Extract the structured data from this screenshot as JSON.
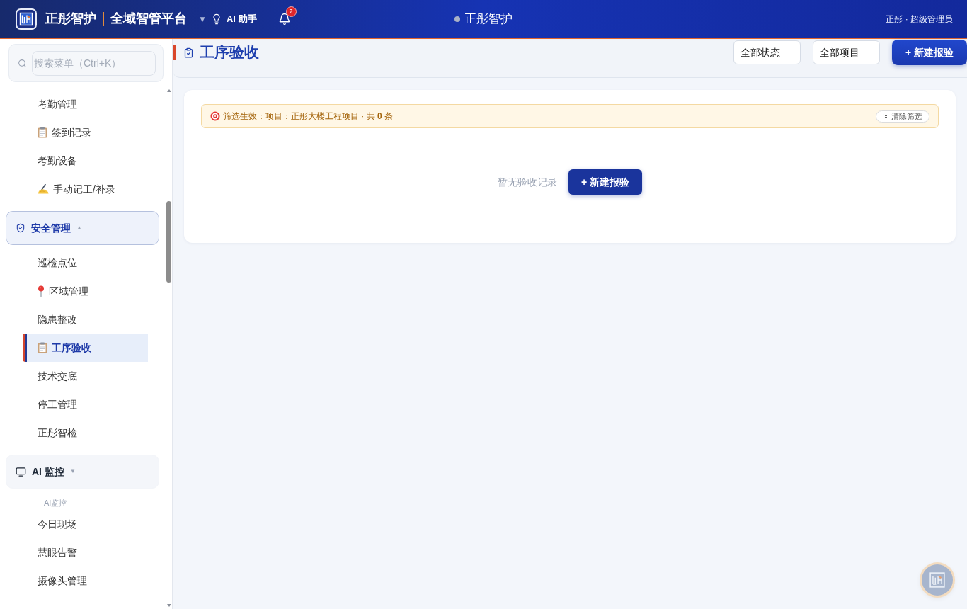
{
  "header": {
    "brand": "正彤智护",
    "platform": "全域智管平台",
    "menu_caret": "▼",
    "ai_assistant": "AI 助手",
    "notification_count": "7",
    "center_title": "正彤智护",
    "user": "正彤 · 超级管理员"
  },
  "sidebar": {
    "search": {
      "placeholder": "搜索菜单（Ctrl+K）"
    },
    "menu": [
      {
        "kind": "item",
        "label": "考勤管理",
        "selected": false
      },
      {
        "kind": "item",
        "label": "签到记录",
        "selected": false
      },
      {
        "kind": "item",
        "label": "考勤设备",
        "selected": false
      },
      {
        "kind": "item",
        "label": "手动记工/补录",
        "selected": false
      },
      {
        "kind": "group",
        "label": "安全管理",
        "caret": "▲",
        "active": true,
        "children": [
          {
            "kind": "item",
            "label": "巡检点位",
            "selected": false
          },
          {
            "kind": "item",
            "label": "区域管理",
            "selected": false
          },
          {
            "kind": "item",
            "label": "隐患整改",
            "selected": false
          },
          {
            "kind": "item",
            "label": "工序验收",
            "selected": true
          },
          {
            "kind": "item",
            "label": "技术交底",
            "selected": false
          },
          {
            "kind": "item",
            "label": "停工管理",
            "selected": false
          },
          {
            "kind": "item",
            "label": "正彤智检",
            "selected": false
          }
        ]
      },
      {
        "kind": "group",
        "label": "AI 监控",
        "caret": "▼",
        "active": false,
        "children": [
          {
            "kind": "section",
            "label": "AI监控"
          },
          {
            "kind": "item",
            "label": "今日现场",
            "selected": false
          },
          {
            "kind": "item",
            "label": "慧眼告警",
            "selected": false
          },
          {
            "kind": "item",
            "label": "摄像头管理",
            "selected": false
          }
        ]
      }
    ]
  },
  "main": {
    "title": "工序验收",
    "filters": [
      {
        "value": "全部状态"
      },
      {
        "value": "全部项目"
      }
    ],
    "new_button": "+ 新建报验",
    "filter_banner": {
      "text": "筛选生效：项目：正彤大楼工程项目 · 共 **0** 条",
      "clear_button": "清除筛选"
    },
    "empty_state": {
      "message": "暂无验收记录",
      "button": "+ 新建报验"
    }
  }
}
